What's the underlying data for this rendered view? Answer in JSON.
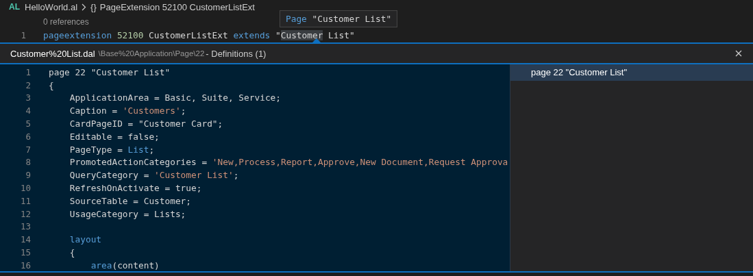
{
  "breadcrumb": {
    "file_icon": "AL",
    "file": "HelloWorld.al",
    "symbol_icon": "{}",
    "symbol": "PageExtension 52100 CustomerListExt"
  },
  "editor": {
    "codelens": "0 references",
    "hover": {
      "tokens": [
        {
          "text": "Page",
          "kind": "keyword"
        },
        {
          "text": " \"Customer List\"",
          "kind": "plain"
        }
      ]
    },
    "lines": [
      {
        "number": "1",
        "tokens": [
          {
            "text": "pageextension",
            "kind": "keyword"
          },
          {
            "text": " 52100",
            "kind": "number"
          },
          {
            "text": " CustomerListExt ",
            "kind": "plain"
          },
          {
            "text": "extends",
            "kind": "keyword"
          },
          {
            "text": " \"",
            "kind": "plain"
          },
          {
            "text": "Customer",
            "kind": "plain",
            "highlight": true
          },
          {
            "text": " List\"",
            "kind": "plain"
          }
        ]
      }
    ]
  },
  "peek": {
    "file": "Customer%20List.dal",
    "path": "\\Base%20Application\\Page\\22",
    "title": "- Definitions (1)",
    "lines": [
      {
        "number": "1",
        "tokens": [
          {
            "text": "page 22 \"Customer List\"",
            "kind": "plain"
          }
        ]
      },
      {
        "number": "2",
        "tokens": [
          {
            "text": "{",
            "kind": "plain"
          }
        ]
      },
      {
        "number": "3",
        "tokens": [
          {
            "text": "    ApplicationArea = Basic, Suite, Service;",
            "kind": "plain"
          }
        ]
      },
      {
        "number": "4",
        "tokens": [
          {
            "text": "    Caption = ",
            "kind": "plain"
          },
          {
            "text": "'Customers'",
            "kind": "string"
          },
          {
            "text": ";",
            "kind": "plain"
          }
        ]
      },
      {
        "number": "5",
        "tokens": [
          {
            "text": "    CardPageID = \"Customer Card\";",
            "kind": "plain"
          }
        ]
      },
      {
        "number": "6",
        "tokens": [
          {
            "text": "    Editable = false;",
            "kind": "plain"
          }
        ]
      },
      {
        "number": "7",
        "tokens": [
          {
            "text": "    PageType = ",
            "kind": "plain"
          },
          {
            "text": "List",
            "kind": "keyword"
          },
          {
            "text": ";",
            "kind": "plain"
          }
        ]
      },
      {
        "number": "8",
        "tokens": [
          {
            "text": "    PromotedActionCategories = ",
            "kind": "plain"
          },
          {
            "text": "'New,Process,Report,Approve,New Document,Request Approva",
            "kind": "string"
          }
        ]
      },
      {
        "number": "9",
        "tokens": [
          {
            "text": "    QueryCategory = ",
            "kind": "plain"
          },
          {
            "text": "'Customer List'",
            "kind": "string"
          },
          {
            "text": ";",
            "kind": "plain"
          }
        ]
      },
      {
        "number": "10",
        "tokens": [
          {
            "text": "    RefreshOnActivate = true;",
            "kind": "plain"
          }
        ]
      },
      {
        "number": "11",
        "tokens": [
          {
            "text": "    SourceTable = Customer;",
            "kind": "plain"
          }
        ]
      },
      {
        "number": "12",
        "tokens": [
          {
            "text": "    UsageCategory = Lists;",
            "kind": "plain"
          }
        ]
      },
      {
        "number": "13"
      },
      {
        "number": "14",
        "tokens": [
          {
            "text": "    layout",
            "kind": "keyword"
          }
        ]
      },
      {
        "number": "15",
        "tokens": [
          {
            "text": "    {",
            "kind": "plain"
          }
        ]
      },
      {
        "number": "16",
        "tokens": [
          {
            "text": "        area",
            "kind": "keyword"
          },
          {
            "text": "(content)",
            "kind": "plain"
          }
        ]
      }
    ],
    "references": [
      {
        "label": "page 22 \"Customer List\"",
        "selected": true
      }
    ]
  }
}
